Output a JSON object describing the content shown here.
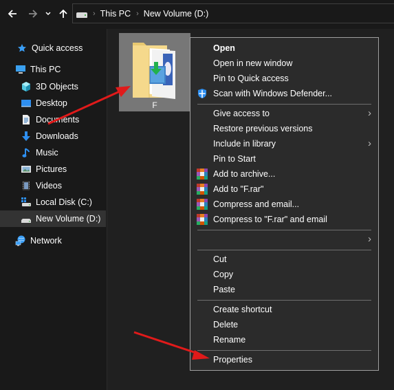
{
  "toolbar": {
    "back_icon": "arrow-left-icon",
    "forward_icon": "arrow-right-icon",
    "recent_icon": "chevron-down-icon",
    "up_icon": "arrow-up-icon",
    "back_glyph": "🡐",
    "forward_glyph": "🡒",
    "recent_glyph": "⌄",
    "up_glyph": "🡑"
  },
  "address": {
    "breadcrumbs": [
      "This PC",
      "New Volume (D:)"
    ],
    "separator": "›"
  },
  "sidebar": {
    "items": [
      {
        "label": "Quick access",
        "icon": "star-icon"
      },
      {
        "label": "This PC",
        "icon": "computer-icon"
      },
      {
        "label": "3D Objects",
        "icon": "cube-icon"
      },
      {
        "label": "Desktop",
        "icon": "desktop-icon"
      },
      {
        "label": "Documents",
        "icon": "document-icon"
      },
      {
        "label": "Downloads",
        "icon": "download-icon"
      },
      {
        "label": "Music",
        "icon": "music-icon"
      },
      {
        "label": "Pictures",
        "icon": "pictures-icon"
      },
      {
        "label": "Videos",
        "icon": "videos-icon"
      },
      {
        "label": "Local Disk (C:)",
        "icon": "system-drive-icon"
      },
      {
        "label": "New Volume (D:)",
        "icon": "drive-icon",
        "selected": true
      },
      {
        "label": "Network",
        "icon": "network-icon"
      }
    ]
  },
  "content": {
    "folder": {
      "name": "F",
      "icon": "folder-icon",
      "selected": true
    }
  },
  "context_menu": {
    "items": [
      {
        "label": "Open",
        "bold": true
      },
      {
        "label": "Open in new window"
      },
      {
        "label": "Pin to Quick access"
      },
      {
        "label": "Scan with Windows Defender...",
        "icon": "defender-shield-icon"
      },
      {
        "label": "Give access to",
        "submenu": true
      },
      {
        "label": "Restore previous versions"
      },
      {
        "label": "Include in library",
        "submenu": true
      },
      {
        "label": "Pin to Start"
      },
      {
        "label": "Add to archive...",
        "icon": "winrar-icon"
      },
      {
        "label": "Add to \"F.rar\"",
        "icon": "winrar-icon"
      },
      {
        "label": "Compress and email...",
        "icon": "winrar-icon"
      },
      {
        "label": "Compress to \"F.rar\" and email",
        "icon": "winrar-icon"
      },
      {
        "label": "",
        "submenu": true
      },
      {
        "label": "Cut"
      },
      {
        "label": "Copy"
      },
      {
        "label": "Paste"
      },
      {
        "label": "Create shortcut"
      },
      {
        "label": "Delete"
      },
      {
        "label": "Rename"
      },
      {
        "label": "Properties"
      }
    ],
    "chevron": "›"
  },
  "annotations": {
    "arrow_color": "#e01a1a"
  },
  "colors": {
    "background": "#191919",
    "content_bg": "#202020",
    "menu_bg": "#2b2b2b",
    "selection": "#777777",
    "accent_blue": "#2e8ff0"
  }
}
